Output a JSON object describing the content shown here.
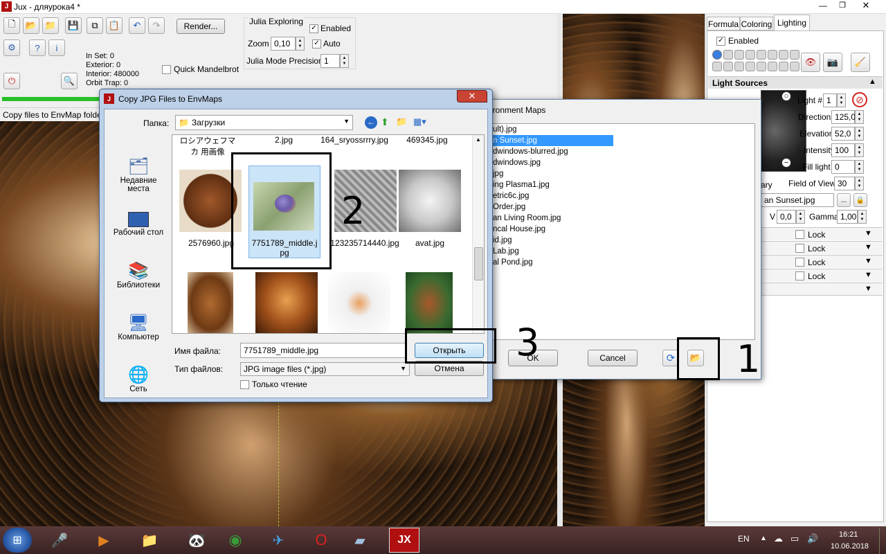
{
  "app": {
    "title": "Jux - дляурока4 *"
  },
  "toolbar": {
    "render_label": "Render...",
    "quick_mandelbrot": "Quick Mandelbrot"
  },
  "stats": {
    "in_set": "In Set: 0",
    "exterior": "Exterior: 0",
    "interior": "Interior: 480000",
    "orbit_trap": "Orbit Trap: 0"
  },
  "julia": {
    "title": "Julia Exploring",
    "enabled_label": "Enabled",
    "zoom_label": "Zoom",
    "zoom_value": "0,10",
    "auto_label": "Auto",
    "precision_label": "Julia Mode Precision",
    "precision_value": "1"
  },
  "statusbar": {
    "text": "Copy files to EnvMap folder"
  },
  "right_panel": {
    "tabs": [
      "Formula",
      "Coloring",
      "Lighting"
    ],
    "enabled_label": "Enabled",
    "light_sources_title": "Light Sources",
    "light_num_label": "Light #",
    "light_num_value": "1",
    "direction_label": "Direction",
    "direction_value": "125,0",
    "elevation_label": "Elevation",
    "elevation_value": "52,0",
    "intensity_label": "Intensity",
    "intensity_value": "100",
    "fill_light_label": "Fill light",
    "fill_light_value": "0",
    "ary_label": "ary",
    "fov_label": "Field of View",
    "fov_value": "30",
    "env_value": "an Sunset.jpg",
    "v_label": "V",
    "v_value": "0,0",
    "gamma_label": "Gamma",
    "gamma_value": "1,00",
    "lock_label": "Lock"
  },
  "env_dialog": {
    "title": "ironment Maps",
    "files": [
      "ult).jpg",
      "n Sunset.jpg",
      "dwindows-blurred.jpg",
      "dwindows.jpg",
      "jpg",
      "ing Plasma1.jpg",
      "etric6c.jpg",
      "Order.jpg",
      "an Living Room.jpg",
      "ncal House.jpg",
      "id.jpg",
      "Lab.jpg",
      "al Pond.jpg"
    ],
    "selected_index": 1,
    "ok_label": "OK",
    "cancel_label": "Cancel"
  },
  "copy_dialog": {
    "title": "Copy JPG Files to EnvMaps",
    "folder_label": "Папка:",
    "folder_value": "Загрузки",
    "places": [
      "Недавние места",
      "Рабочий стол",
      "Библиотеки",
      "Компьютер",
      "Сеть"
    ],
    "top_row": [
      "ロシアウェフマカ 用画像",
      "2.jpg",
      "164_sryossrrry.jpg",
      "469345.jpg"
    ],
    "row1": [
      "2576960.jpg",
      "7751789_middle.jpg",
      "123235714440.jpg",
      "avat.jpg"
    ],
    "filename_label": "Имя файла:",
    "filename_value": "7751789_middle.jpg",
    "filetype_label": "Тип файлов:",
    "filetype_value": "JPG image files (*.jpg)",
    "readonly_label": "Только чтение",
    "open_label": "Открыть",
    "cancel_label": "Отмена"
  },
  "annotations": {
    "n1": "1",
    "n2": "2",
    "n3": "3"
  },
  "taskbar": {
    "lang": "EN",
    "time": "16:21",
    "date": "10.06.2018"
  }
}
